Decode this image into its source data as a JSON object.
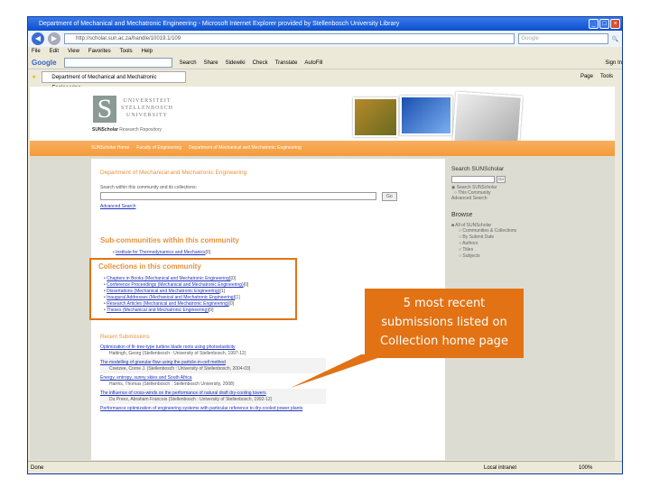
{
  "window": {
    "title": "Department of Mechanical and Mechatronic Engineering - Microsoft Internet Explorer provided by Stellenbosch University Library",
    "url": "http://scholar.sun.ac.za/handle/10019.1/109",
    "search_placeholder": "Google"
  },
  "menu": [
    "File",
    "Edit",
    "View",
    "Favorites",
    "Tools",
    "Help"
  ],
  "google_bar": {
    "logo": "Google",
    "items": [
      "Search",
      "Share",
      "Sidewiki",
      "Check",
      "Translate",
      "AutoFill"
    ],
    "sign_in": "Sign In"
  },
  "tab": {
    "label": "Department of Mechanical and Mechatronic Engineering",
    "tools": [
      "Page",
      "Tools"
    ]
  },
  "header": {
    "logo_letter": "S",
    "uni_lines": [
      "UNIVERSITEIT",
      "STELLENBOSCH",
      "UNIVERSITY"
    ],
    "sun_bold": "SUNScholar",
    "sun_rest": " Research Repository"
  },
  "breadcrumbs": [
    "SUNScholar Home",
    "Faculty of Engineering",
    "Department of Mechanical and Mechatronic Engineering"
  ],
  "main": {
    "title": "Department of Mechanical and Mechatronic Engineering",
    "search_label": "Search within this community and its collections:",
    "go": "Go",
    "advanced": "Advanced Search",
    "sub_heading": "Sub-communities within this community",
    "sub": [
      {
        "name": "Institute for Thermodynamics and Mechanics",
        "count": "[0]"
      }
    ],
    "coll_heading": "Collections in this community",
    "collections": [
      {
        "name": "Chapters in Books (Mechanical and Mechatronic Engineering)",
        "count": "[0]"
      },
      {
        "name": "Conference Proceedings (Mechanical and Mechatronic Engineering)",
        "count": "[0]"
      },
      {
        "name": "Dissertations (Mechanical and Mechatronic Engineering)",
        "count": "[1]"
      },
      {
        "name": "Inaugural Addresses (Mechanical and Mechatronic Engineering)",
        "count": "[1]"
      },
      {
        "name": "Research Articles (Mechanical and Mechatronic Engineering)",
        "count": "[0]"
      },
      {
        "name": "Theses (Mechanical and Mechatronic Engineering)",
        "count": "[9]"
      }
    ],
    "recent_heading": "Recent Submissions",
    "recent": [
      {
        "title": "Optimization of fir-tree-type turbine blade roots using photoelasticity",
        "author": "Hattingh, Georg (Stellenbosch : University of Stellenbosch, 1997-12)"
      },
      {
        "title": "The modelling of granular flow using the particle-in-cell method",
        "author": "Coetzee, Corne J. (Stellenbosch : University of Stellenbosch, 2004-03)"
      },
      {
        "title": "Energy, entropy, sunny skies and South Africa",
        "author": "Harms, Thomas (Stellenbosch : Stellenbosch University, 2008)"
      },
      {
        "title": "The influence of cross-winds on the performance of natural draft dry-cooling towers",
        "author": "Du Preez, Abraham Francois (Stellenbosch : University of Stellenbosch, 1992-12)"
      },
      {
        "title": "Performance optimization of engineering systems with particular reference to dry-cooled power plants",
        "author": ""
      }
    ]
  },
  "side": {
    "search_title": "Search SUNScholar",
    "go": "Go",
    "radio1": "Search SUNScholar",
    "radio2": "This Community",
    "advanced": "Advanced Search",
    "browse": "Browse",
    "all": "All of SUNScholar",
    "items": [
      "Communities & Collections",
      "By Submit Date",
      "Authors",
      "Titles",
      "Subjects"
    ]
  },
  "callout": {
    "lines": [
      "5 most recent",
      "submissions listed on",
      "Collection home page"
    ]
  },
  "status": {
    "left": "Done",
    "zone": "Local intranet",
    "zoom": "100%"
  },
  "colors": {
    "accent": "#e27214",
    "nav": "#f59a3a"
  }
}
